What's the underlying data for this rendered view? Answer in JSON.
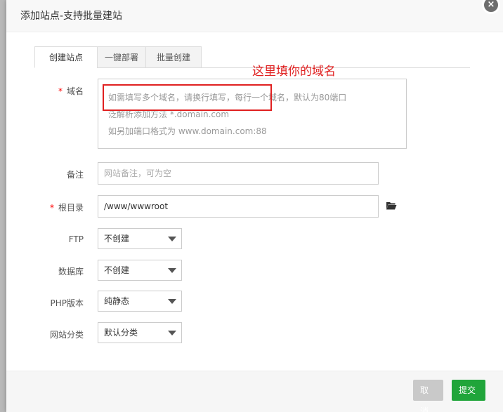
{
  "dialog": {
    "title": "添加站点-支持批量建站",
    "close_glyph": "×"
  },
  "tabs": [
    {
      "label": "创建站点",
      "active": true
    },
    {
      "label": "一键部署",
      "active": false
    },
    {
      "label": "批量创建",
      "active": false
    }
  ],
  "annotation": {
    "text": "这里填你的域名",
    "color": "#e02020"
  },
  "form": {
    "domain": {
      "required_mark": "*",
      "label": "域名",
      "placeholder_lines": [
        "如需填写多个域名，请换行填写，每行一个域名，默认为80端口",
        "泛解析添加方法 *.domain.com",
        "如另加端口格式为 www.domain.com:88"
      ]
    },
    "remark": {
      "label": "备注",
      "placeholder": "网站备注，可为空"
    },
    "root": {
      "required_mark": "*",
      "label": "根目录",
      "value": "/www/wwwroot",
      "icon": "folder-open-icon"
    },
    "ftp": {
      "label": "FTP",
      "value": "不创建"
    },
    "database": {
      "label": "数据库",
      "value": "不创建"
    },
    "php": {
      "label": "PHP版本",
      "value": "纯静态"
    },
    "category": {
      "label": "网站分类",
      "value": "默认分类"
    }
  },
  "footer": {
    "cancel_label": "取消",
    "submit_label": "提交",
    "submit_color": "#20a53a"
  }
}
